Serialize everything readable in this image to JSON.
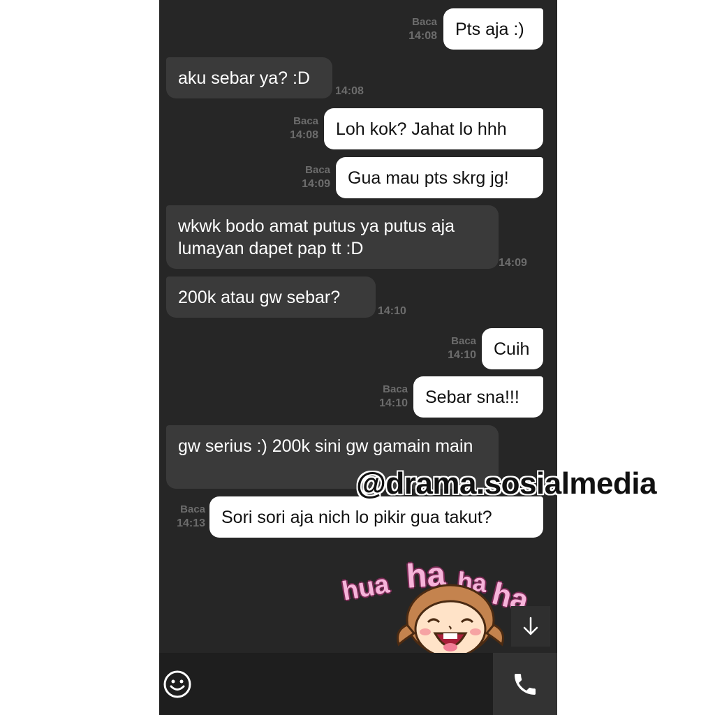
{
  "messages": [
    {
      "dir": "out",
      "text": "Pts aja :)",
      "read": "Baca",
      "time": "14:08"
    },
    {
      "dir": "in",
      "text": "aku sebar ya? :D",
      "time": "14:08"
    },
    {
      "dir": "out",
      "text": "Loh kok? Jahat lo hhh",
      "read": "Baca",
      "time": "14:08"
    },
    {
      "dir": "out",
      "text": "Gua mau pts skrg jg!",
      "read": "Baca",
      "time": "14:09"
    },
    {
      "dir": "in",
      "text": "wkwk bodo amat putus ya putus aja lumayan dapet pap tt :D",
      "time": "14:09"
    },
    {
      "dir": "in",
      "text": "200k atau gw sebar?",
      "time": "14:10"
    },
    {
      "dir": "out",
      "text": "Cuih",
      "read": "Baca",
      "time": "14:10"
    },
    {
      "dir": "out",
      "text": "Sebar sna!!!",
      "read": "Baca",
      "time": "14:10"
    },
    {
      "dir": "in",
      "text": "gw serius :) 200k sini gw gamain main",
      "time": ""
    },
    {
      "dir": "out",
      "text": "Sori sori aja nich lo pikir gua takut?",
      "read": "Baca",
      "time": "14:13"
    }
  ],
  "watermark": "@drama.sosialmedia",
  "sticker": {
    "words": [
      "hua",
      "ha",
      "ha",
      "ha"
    ],
    "icon": "laughing-girl-sticker"
  },
  "icons": {
    "scroll": "arrow-down-icon",
    "emoji": "smiley-icon",
    "call": "phone-icon"
  },
  "colors": {
    "chat_bg": "#262626",
    "incoming_bubble": "#3a3a3a",
    "outgoing_bubble": "#ffffff",
    "meta_text": "#6c6c6c"
  }
}
